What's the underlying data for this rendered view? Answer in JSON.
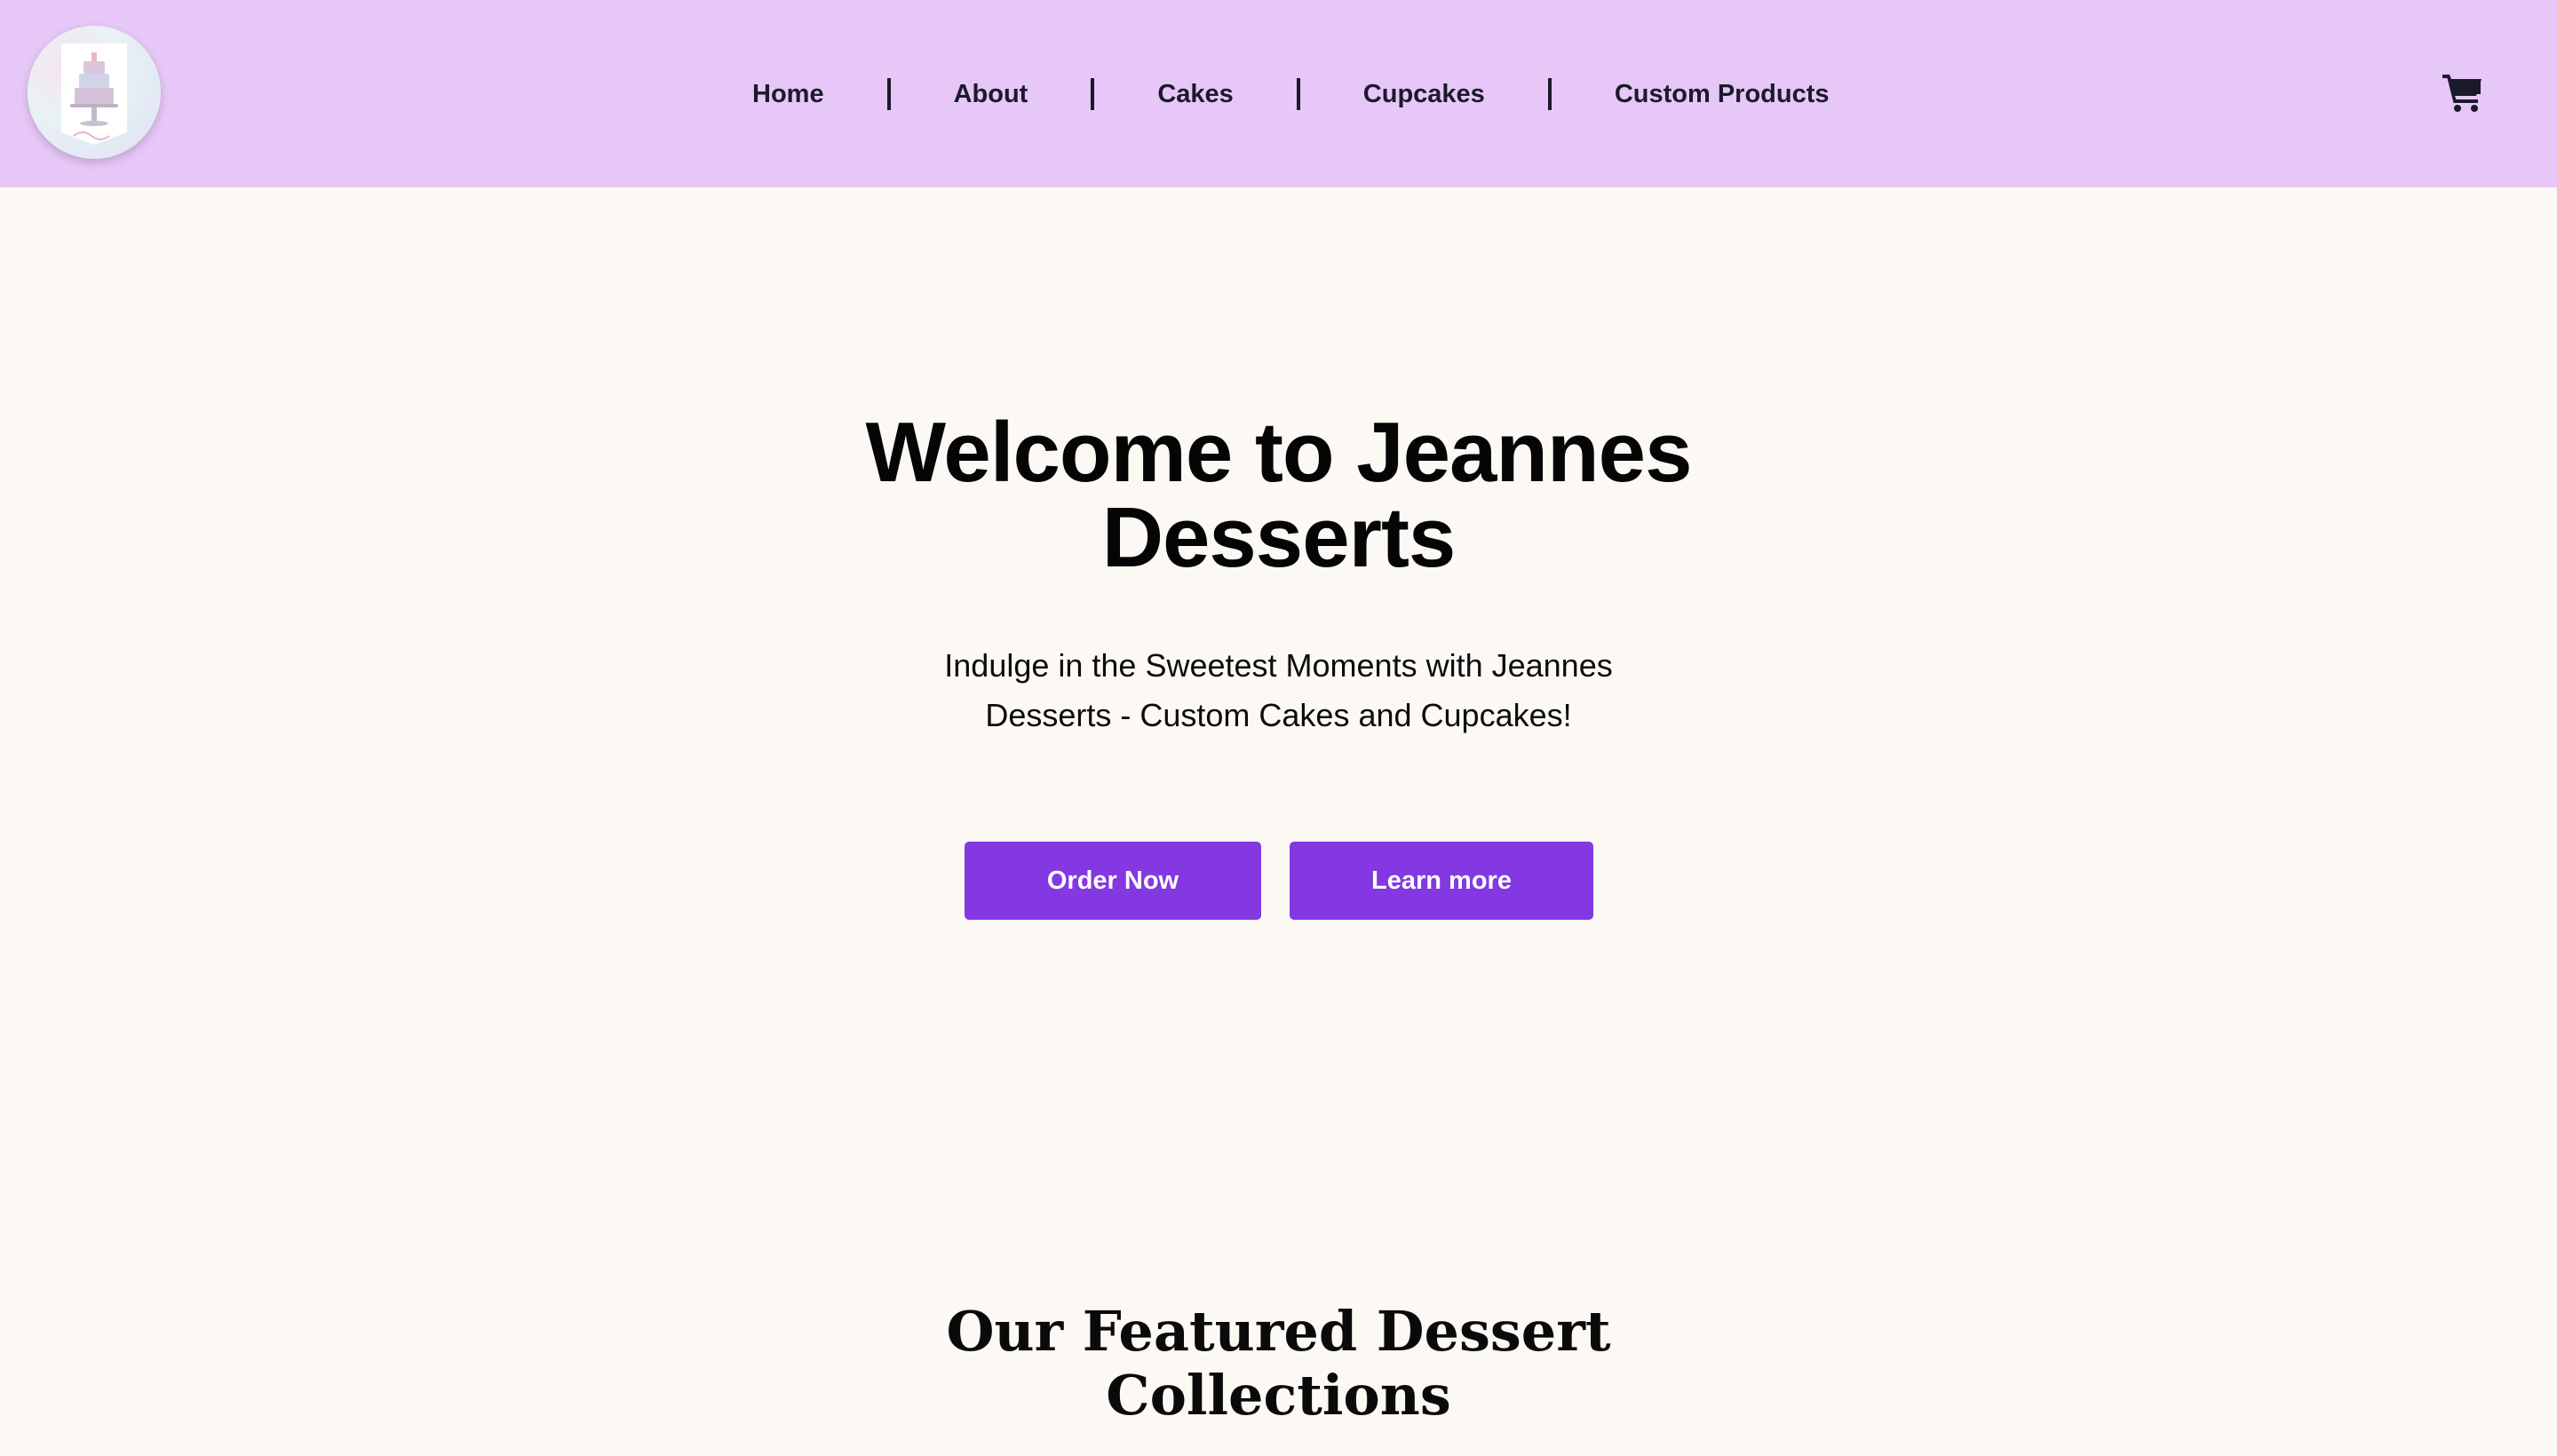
{
  "header": {
    "logo": {
      "icon": "cake-logo-icon"
    },
    "nav": [
      {
        "label": "Home"
      },
      {
        "label": "About"
      },
      {
        "label": "Cakes"
      },
      {
        "label": "Cupcakes"
      },
      {
        "label": "Custom Products"
      }
    ],
    "cart": {
      "icon": "cart-icon"
    }
  },
  "hero": {
    "title_line1": "Welcome to Jeannes",
    "title_line2": "Desserts",
    "subtitle_line1": "Indulge in the Sweetest Moments with Jeannes",
    "subtitle_line2": "Desserts - Custom Cakes and Cupcakes!",
    "buttons": {
      "order": "Order Now",
      "learn": "Learn more"
    }
  },
  "featured": {
    "title_line1": "Our Featured Dessert",
    "title_line2": "Collections"
  },
  "colors": {
    "header_bg": "#e6c7f7",
    "page_bg": "#fcf9f5",
    "accent": "#8338e1",
    "nav_text": "#1b1a2a"
  }
}
